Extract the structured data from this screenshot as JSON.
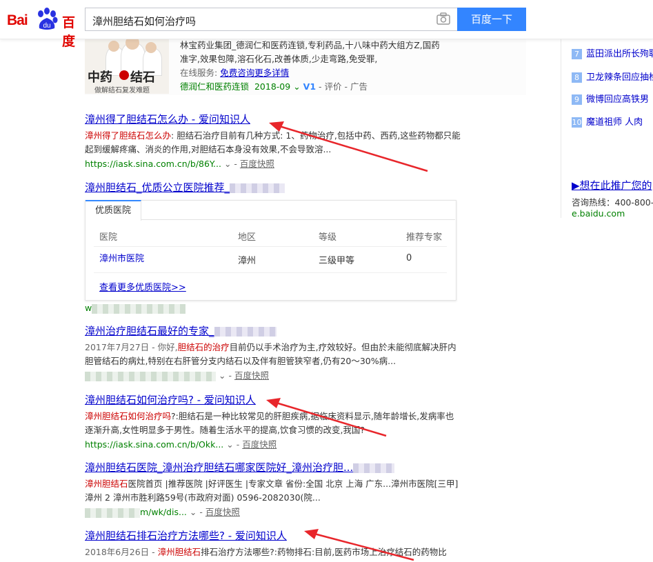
{
  "header": {
    "logo_bai": "Bai",
    "logo_du_small": "du",
    "logo_cn": "百度",
    "query": "漳州胆结石如何治疗吗",
    "search_button": "百度一下"
  },
  "ad": {
    "img_big": "中药",
    "img_seal": "治",
    "img_big2": "结石",
    "img_small": "做解结石复发难题",
    "line1": "林宝药业集团_德润仁和医药连锁,专利药品,十八味中药大组方Z,国药",
    "line2": "准字,效果包障,溶石化石,改善体质,少走弯路,免受罪,",
    "service_label": "在线服务:",
    "service_link": "免费咨询更多详情",
    "meta_source": "德润仁和医药连锁",
    "meta_date": "2018-09",
    "meta_v": "V1",
    "meta_eval": "评价",
    "meta_ad": "广告"
  },
  "results": [
    {
      "title": "漳州得了胆结石怎么办 - 爱问知识人",
      "abs_hl": "漳州得了胆结石怎么办",
      "abs": ": 胆结石治疗目前有几种方式: 1、药物治疗,包括中药、西药,这些药物都只能起到缓解疼痛、消炎的作用,对胆结石本身没有效果,不会导致溶...",
      "url": "https://iask.sina.com.cn/b/86Y...",
      "snap": "百度快照"
    },
    {
      "title": "漳州胆结石_优质公立医院推荐_"
    },
    {
      "title": "漳州治疗胆结石最好的专家_",
      "date": "2017年7月27日",
      "abs_pre": " - 你好,",
      "abs_hl": "胆结石的治疗",
      "abs": "目前仍以手术治疗为主,疗效较好。但由於未能彻底解决肝内胆管结石的病灶,特别在右肝管分支内结石以及伴有胆管狭窄者,仍有20～30%病...",
      "snap": "百度快照"
    },
    {
      "title": "漳州胆结石如何治疗吗? - 爱问知识人",
      "abs_hl": "漳州胆结石如何治疗吗",
      "abs": "?:胆结石是一种比较常见的肝胆疾病,据临床资料显示,随年龄增长,发病率也逐渐升高,女性明显多于男性。随着生活水平的提高,饮食习惯的改变,我国?",
      "url": "https://iask.sina.com.cn/b/Okk...",
      "snap": "百度快照"
    },
    {
      "title": "漳州胆结石医院_漳州治疗胆结石哪家医院好_漳州治疗胆...",
      "abs_hl": "漳州胆结石",
      "abs": "医院首页 |推荐医院 |好评医生 |专家文章 省份:全国 北京 上海 广东...漳州市医院[三甲] 漳州 2 漳州市胜利路59号(市政府对面) 0596-2082030(院...",
      "url": "m/wk/dis...",
      "snap": "百度快照"
    },
    {
      "title": "漳州胆结石排石治疗方法哪些? - 爱问知识人",
      "date": "2018年6月26日",
      "abs_hl": "漳州胆结石",
      "abs": "排石治疗方法哪些?:药物排石:目前,医药市场上治疗结石的药物比"
    }
  ],
  "hospital_card": {
    "tab": "优质医院",
    "headers": [
      "医院",
      "地区",
      "等级",
      "推荐专家"
    ],
    "row": [
      "漳州市医院",
      "漳州",
      "三级甲等",
      "0"
    ],
    "more": "查看更多优质医院>>",
    "url_frag": "w"
  },
  "sidebar": {
    "hot": [
      {
        "num": "7",
        "text": "蓝田派出所长殉职"
      },
      {
        "num": "8",
        "text": "卫龙辣条回应抽检"
      },
      {
        "num": "9",
        "text": "微博回应高铁男"
      },
      {
        "num": "10",
        "text": "魔道祖师 人肉"
      }
    ],
    "promo": "▶想在此推广您的",
    "hotline": "咨询热线：400-800-",
    "domain": "e.baidu.com"
  },
  "colors": {
    "link": "#0000cc",
    "highlight": "#cc0000",
    "url_green": "#008000",
    "button_blue": "#3385ff",
    "annotation_arrow": "#e8262b"
  }
}
